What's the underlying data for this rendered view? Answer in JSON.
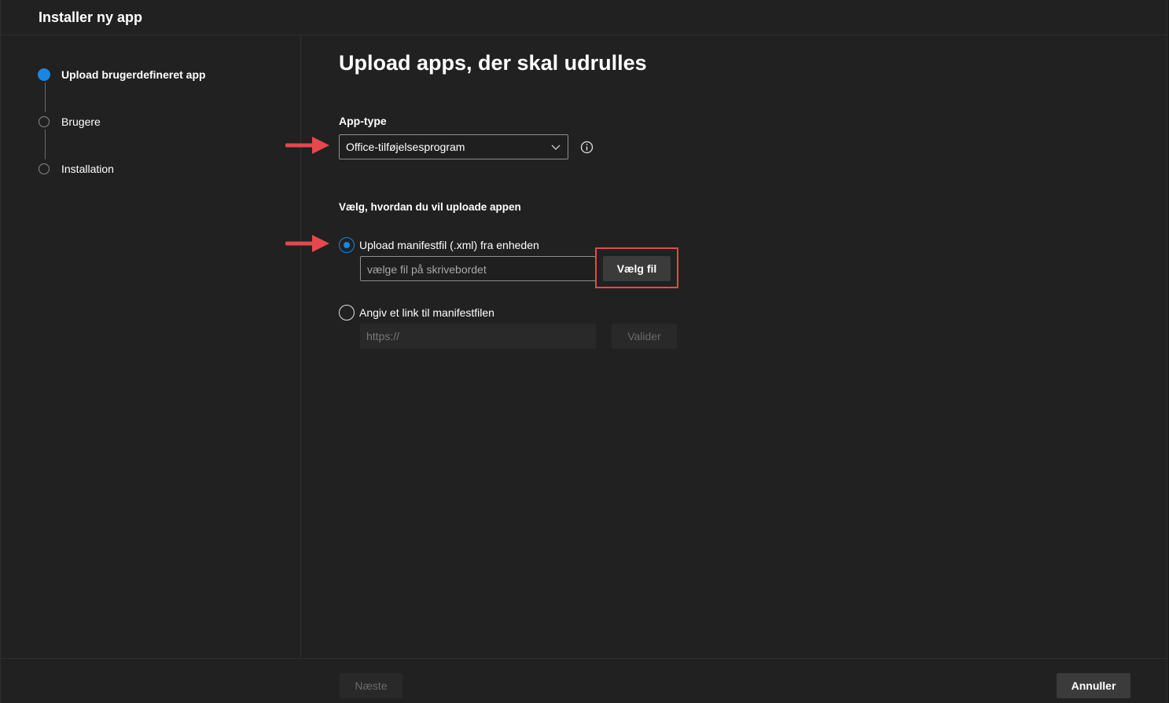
{
  "window": {
    "title": "Installer ny app"
  },
  "steps": [
    {
      "label": "Upload brugerdefineret app",
      "active": true
    },
    {
      "label": "Brugere",
      "active": false
    },
    {
      "label": "Installation",
      "active": false
    }
  ],
  "main": {
    "title": "Upload apps, der skal udrulles",
    "app_type": {
      "label": "App-type",
      "selected": "Office-tilføjelsesprogram"
    },
    "upload_section": {
      "label": "Vælg, hvordan du vil uploade appen",
      "option_file": {
        "label": "Upload manifestfil (.xml) fra enheden",
        "checked": true,
        "placeholder": "vælge fil på skrivebordet",
        "button": "Vælg fil"
      },
      "option_link": {
        "label": "Angiv et link til manifestfilen",
        "checked": false,
        "placeholder": "https://",
        "button": "Valider"
      }
    }
  },
  "footer": {
    "next": "Næste",
    "cancel": "Annuller"
  },
  "colors": {
    "accent": "#1a86e0",
    "highlight": "#e5484d",
    "background": "#212121"
  }
}
